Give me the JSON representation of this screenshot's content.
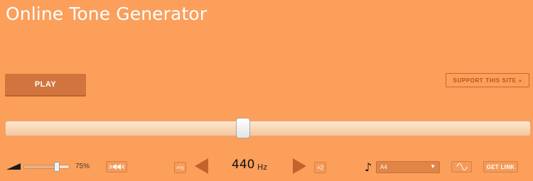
{
  "app": {
    "title": "Online Tone Generator"
  },
  "buttons": {
    "play": "PLAY",
    "support": "SUPPORT THIS SITE »",
    "half": "×½",
    "double": "×2",
    "get_link": "GET LINK"
  },
  "frequency": {
    "value": "440",
    "unit": "Hz",
    "slider_fraction": 0.45
  },
  "volume": {
    "label": "75%",
    "value": 0.75
  },
  "note": {
    "selected": "A4"
  },
  "colors": {
    "background": "#fb9f5b",
    "button": "#d1743d",
    "accent_text": "#b8541f"
  },
  "icons": {
    "volume": "volume-triangle-icon",
    "balance": "stereo-balance-icon",
    "prev": "triangle-left-icon",
    "next": "triangle-right-icon",
    "note": "music-note-icon",
    "wave": "sine-wave-icon",
    "dropdown": "chevron-down-icon"
  }
}
